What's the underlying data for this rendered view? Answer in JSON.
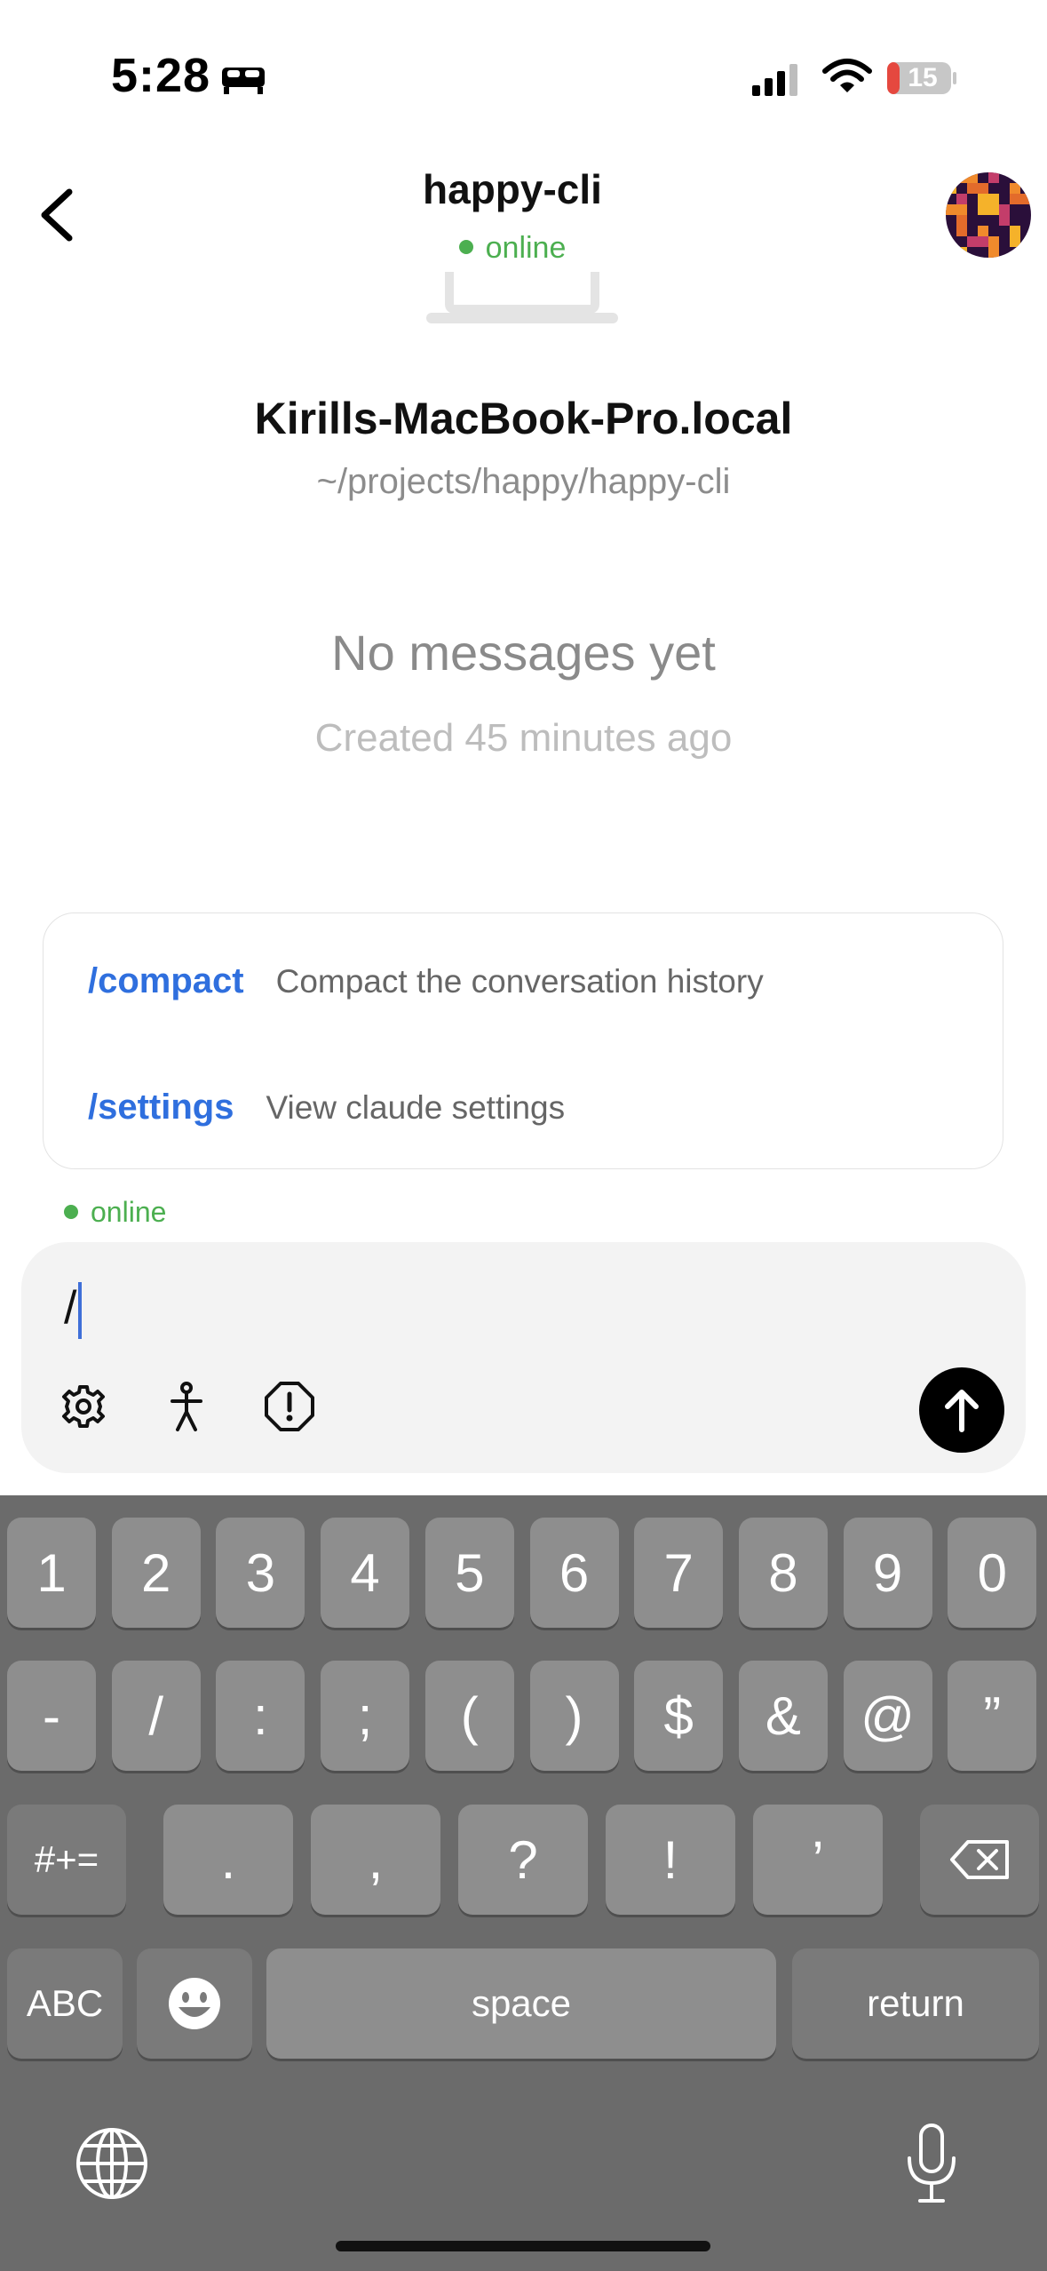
{
  "status_bar": {
    "time": "5:28",
    "battery": "15"
  },
  "header": {
    "title": "happy-cli",
    "status": "online"
  },
  "machine": {
    "host": "Kirills-MacBook-Pro.local",
    "path": "~/projects/happy/happy-cli"
  },
  "empty_state": {
    "title": "No messages yet",
    "subtitle": "Created 45 minutes ago"
  },
  "suggestions": [
    {
      "command": "/compact",
      "description": "Compact the conversation history"
    },
    {
      "command": "/settings",
      "description": "View claude settings"
    }
  ],
  "connection_status": "online",
  "input": {
    "value": "/"
  },
  "colors": {
    "online": "#4caf50",
    "command": "#2f6fde",
    "caret": "#3f6fd8"
  },
  "keyboard": {
    "row1": [
      "1",
      "2",
      "3",
      "4",
      "5",
      "6",
      "7",
      "8",
      "9",
      "0"
    ],
    "row2": [
      "-",
      "/",
      ":",
      ";",
      "(",
      ")",
      "$",
      "&",
      "@",
      "”"
    ],
    "row3": [
      ".",
      ",",
      "?",
      "!",
      "’"
    ],
    "shift_label": "#+=",
    "abc_label": "ABC",
    "space_label": "space",
    "return_label": "return"
  },
  "icons": [
    "back-icon",
    "bed-icon",
    "signal-icon",
    "wifi-icon",
    "battery-icon",
    "laptop-icon",
    "settings-gear-icon",
    "person-icon",
    "alert-icon",
    "send-arrow-icon",
    "backspace-icon",
    "emoji-icon",
    "globe-icon",
    "microphone-icon"
  ]
}
